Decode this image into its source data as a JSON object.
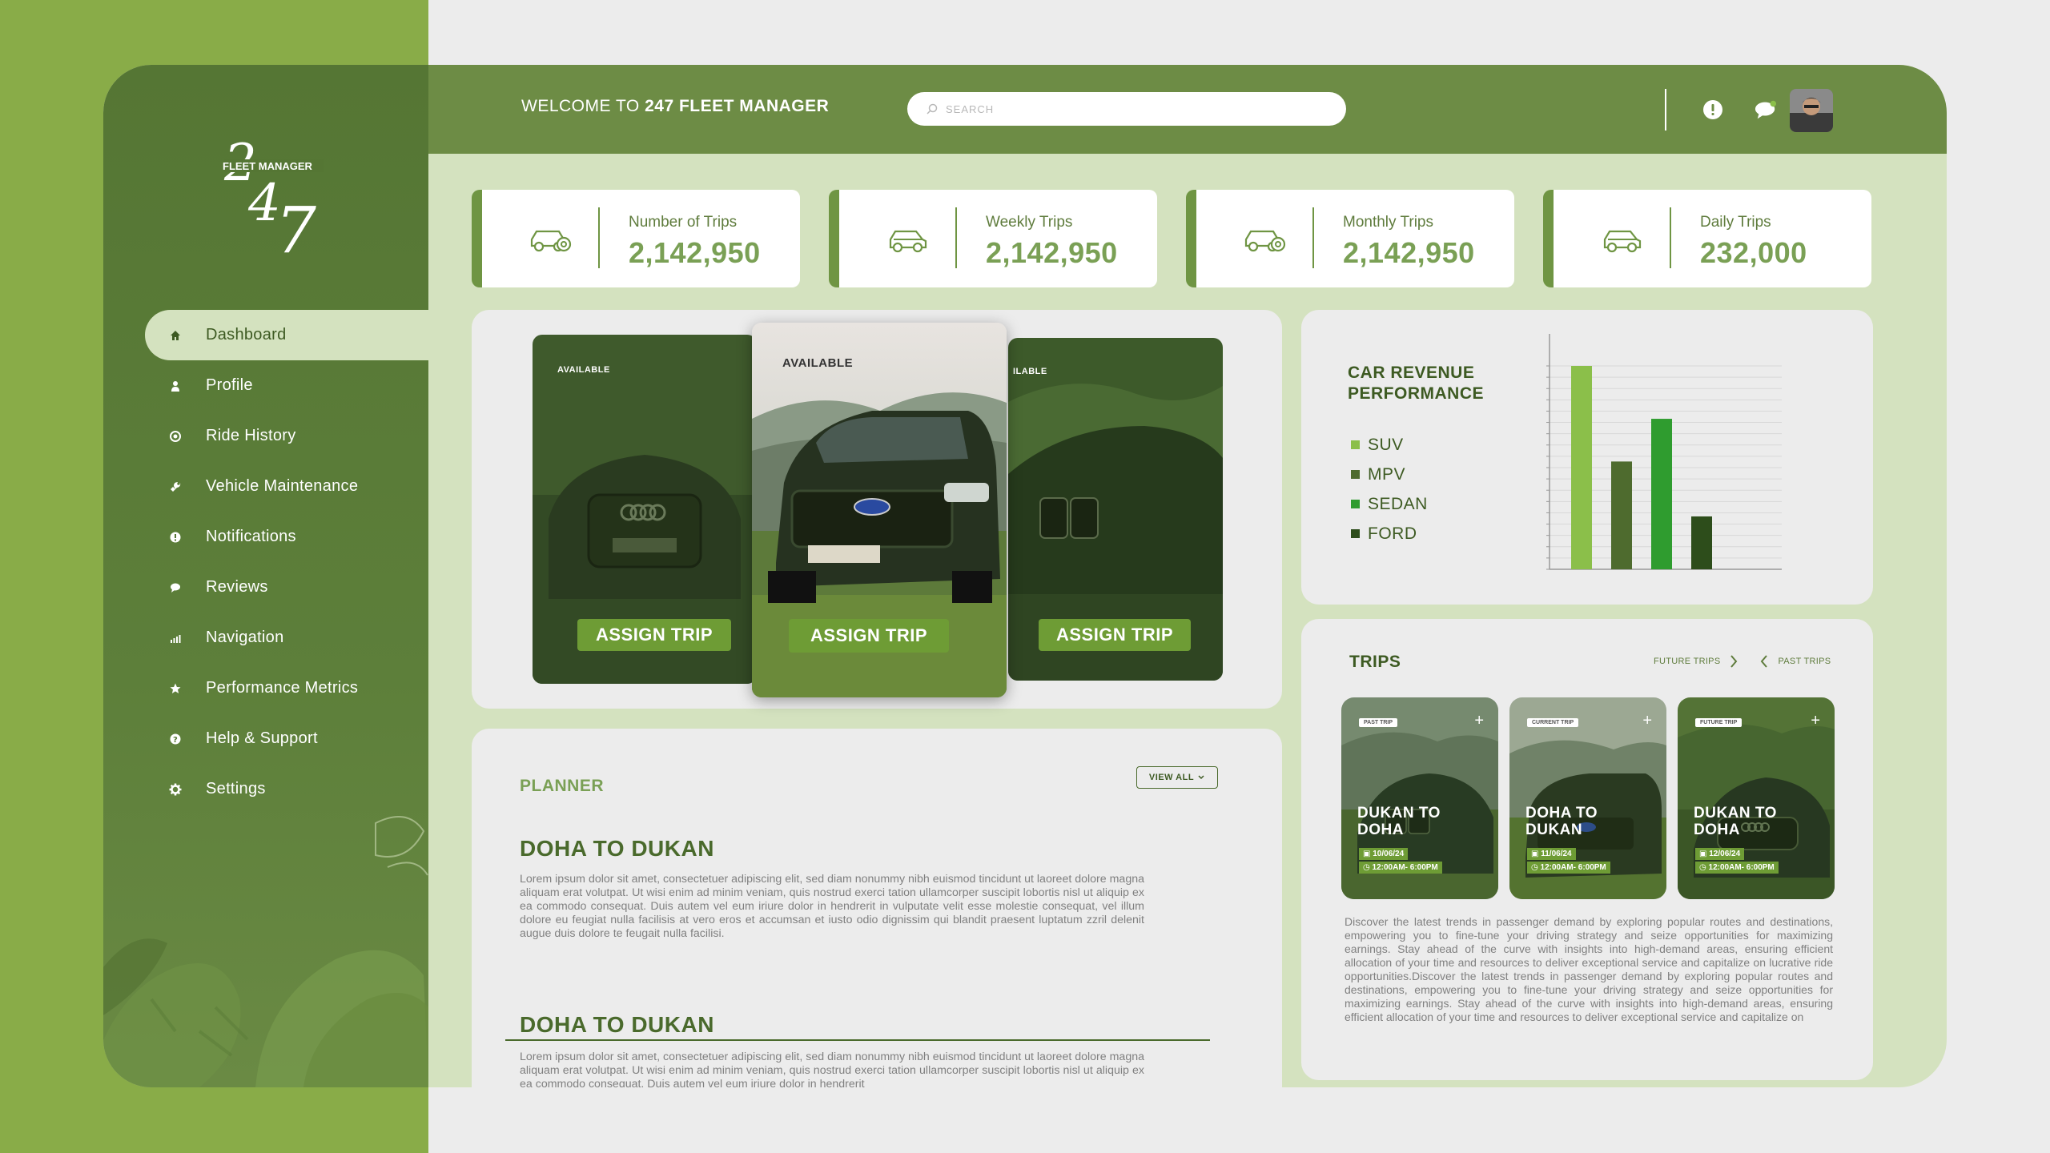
{
  "app": {
    "welcome_prefix": "WELCOME TO",
    "welcome_name": "247 FLEET MANAGER",
    "logo_numbers": "247",
    "logo_text": "FLEET MANAGER",
    "search_placeholder": "SEARCH"
  },
  "colors": {
    "accent": "#6e9c35",
    "sidebar": "#557634",
    "topbar": "#6d8c45",
    "content_bg": "#d4e2bf",
    "side_band": "#89ac48"
  },
  "topbar": {
    "icons": [
      "alert-icon",
      "chat-icon"
    ]
  },
  "sidebar": {
    "items": [
      {
        "label": "Dashboard",
        "icon": "home-icon",
        "active": true
      },
      {
        "label": "Profile",
        "icon": "user-icon"
      },
      {
        "label": "Ride History",
        "icon": "history-icon"
      },
      {
        "label": "Vehicle Maintenance",
        "icon": "wrench-icon"
      },
      {
        "label": "Notifications",
        "icon": "alert-icon"
      },
      {
        "label": "Reviews",
        "icon": "chat-icon"
      },
      {
        "label": "Navigation",
        "icon": "bars-icon"
      },
      {
        "label": "Performance Metrics",
        "icon": "star-icon"
      },
      {
        "label": "Help & Support",
        "icon": "question-icon"
      },
      {
        "label": "Settings",
        "icon": "gear-icon"
      }
    ]
  },
  "stats": [
    {
      "label": "Number of Trips",
      "value": "2,142,950",
      "icon": "car-gear-icon"
    },
    {
      "label": "Weekly Trips",
      "value": "2,142,950",
      "icon": "car-icon"
    },
    {
      "label": "Monthly Trips",
      "value": "2,142,950",
      "icon": "car-gear-icon"
    },
    {
      "label": "Daily Trips",
      "value": "232,000",
      "icon": "car-icon"
    }
  ],
  "vehicles": {
    "cards": [
      {
        "status": "AVAILABLE",
        "button": "ASSIGN TRIP"
      },
      {
        "status": "AVAILABLE",
        "button": "ASSIGN TRIP"
      },
      {
        "status": "ILABLE",
        "button": "ASSIGN TRIP"
      }
    ]
  },
  "planner": {
    "title": "PLANNER",
    "view_all": "VIEW ALL",
    "entries": [
      {
        "title": "DOHA TO DUKAN",
        "body": "Lorem ipsum dolor sit amet, consectetuer adipiscing elit, sed diam nonummy nibh euismod tincidunt ut laoreet dolore magna aliquam erat volutpat. Ut wisi enim ad minim veniam, quis nostrud exerci tation ullamcorper suscipit lobortis nisl ut aliquip ex ea commodo consequat. Duis autem vel eum iriure dolor in hendrerit in vulputate velit esse molestie consequat, vel illum dolore eu feugiat nulla facilisis at vero eros et accumsan et iusto odio dignissim qui blandit praesent luptatum zzril delenit augue duis dolore te feugait nulla facilisi."
      },
      {
        "title": "DOHA TO DUKAN",
        "body": "Lorem ipsum dolor sit amet, consectetuer adipiscing elit, sed diam nonummy nibh euismod tincidunt ut laoreet dolore magna aliquam erat volutpat. Ut wisi enim ad minim veniam, quis nostrud exerci tation ullamcorper suscipit lobortis nisl ut aliquip ex ea commodo consequat. Duis autem vel eum iriure dolor in hendrerit"
      }
    ]
  },
  "revenue": {
    "title": "CAR REVENUE PERFORMANCE"
  },
  "chart_data": {
    "type": "bar",
    "title": "CAR REVENUE PERFORMANCE",
    "categories": [
      "SUV",
      "MPV",
      "SEDAN",
      "FORD"
    ],
    "values": [
      100,
      53,
      74,
      26
    ],
    "colors": [
      "#8bbf4a",
      "#4e6b2e",
      "#2f9c2f",
      "#2d4d1b"
    ],
    "ylim": [
      0,
      100
    ],
    "grid": true,
    "legend": "left"
  },
  "trips": {
    "title": "TRIPS",
    "future_label": "FUTURE TRIPS",
    "past_label": "PAST TRIPS",
    "cards": [
      {
        "badge": "PAST TRIP",
        "title_line1": "DUKAN TO",
        "title_line2": "DOHA",
        "date": "10/06/24",
        "time": "12:00AM- 6:00PM"
      },
      {
        "badge": "CURRENT TRIP",
        "title_line1": "DOHA TO",
        "title_line2": "DUKAN",
        "date": "11/06/24",
        "time": "12:00AM- 6:00PM"
      },
      {
        "badge": "FUTURE TRIP",
        "title_line1": "DUKAN TO",
        "title_line2": "DOHA",
        "date": "12/06/24",
        "time": "12:00AM- 6:00PM"
      }
    ],
    "description": "Discover the latest trends in passenger demand by exploring popular routes and destinations, empowering you to fine-tune your driving strategy and seize opportunities for maximizing earnings. Stay ahead of the curve with insights into high-demand areas, ensuring efficient allocation of your time and resources to deliver exceptional service and capitalize on lucrative ride opportunities.Discover the latest trends in passenger demand by exploring popular routes and destinations, empowering you to fine-tune your driving strategy and seize opportunities for maximizing earnings. Stay ahead of the curve with insights into high-demand areas, ensuring efficient allocation of your time and resources to deliver exceptional service and capitalize on"
  }
}
